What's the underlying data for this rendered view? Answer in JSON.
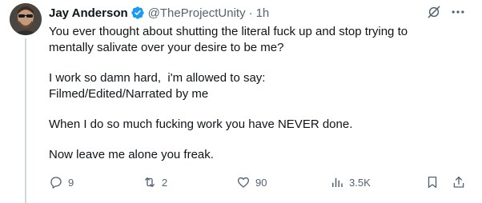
{
  "tweet": {
    "author_name": "Jay Anderson",
    "handle": "@TheProjectUnity",
    "separator": "·",
    "time": "1h",
    "lines": [
      "You ever thought about shutting the literal fuck up and stop trying to",
      "mentally salivate over your desire to be me?",
      "",
      "I work so damn hard,  i'm allowed to say:",
      "Filmed/Edited/Narrated by me",
      "",
      "When I do so much fucking work you have NEVER done.",
      "",
      "Now leave me alone you freak."
    ]
  },
  "actions": {
    "replies": "9",
    "reposts": "2",
    "likes": "90",
    "views": "3.5K"
  },
  "icons": {
    "verified": "verified-badge-icon",
    "grok": "grok-icon",
    "more": "more-icon",
    "reply": "reply-icon",
    "repost": "repost-icon",
    "like": "like-icon",
    "views": "views-icon",
    "bookmark": "bookmark-icon",
    "share": "share-icon"
  },
  "colors": {
    "text": "#0f1419",
    "muted": "#536471",
    "verified": "#1d9bf0",
    "thread_line": "#cfd9de"
  }
}
